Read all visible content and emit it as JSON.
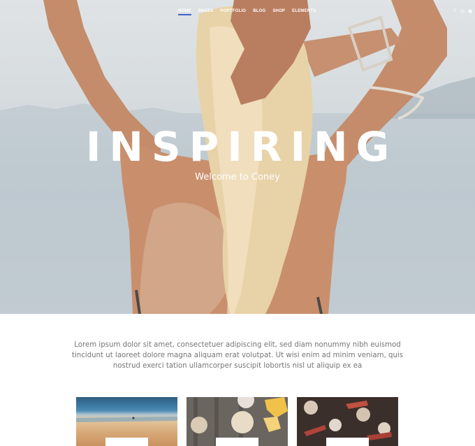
{
  "nav": {
    "items": [
      "Home",
      "Pages",
      "Portfolio",
      "Blog",
      "Shop",
      "Elements"
    ],
    "active_index": 0
  },
  "social": [
    "facebook-icon",
    "instagram-icon",
    "dribbble-icon"
  ],
  "hero": {
    "title": "INSPIRING",
    "subtitle": "Welcome to Coney"
  },
  "intro": {
    "text": "Lorem ipsum dolor sit amet, consectetuer adipiscing elit, sed diam nonummy nibh euismod tincidunt ut laoreet dolore magna aliquam erat volutpat. Ut wisi enim ad minim veniam, quis nostrud exerci tation ullamcorper suscipit lobortis nisl ut aliquip ex ea"
  },
  "colors": {
    "accent": "#3f63c8",
    "text_muted": "#767676"
  }
}
